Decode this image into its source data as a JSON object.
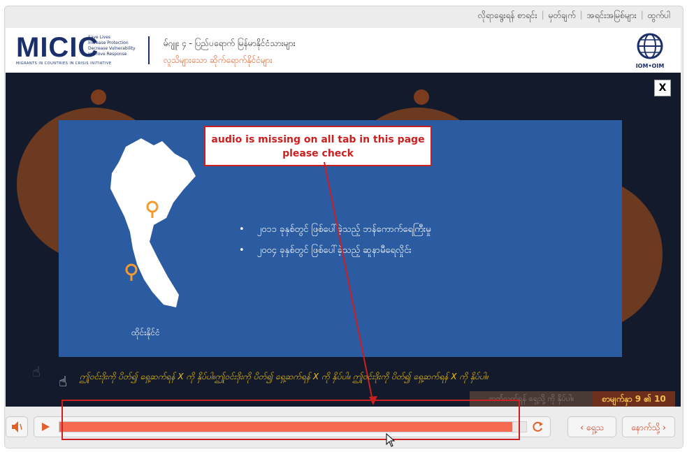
{
  "topnav": {
    "items": [
      "လိုရာရွေးရန် စာရင်း",
      "မှတ်ချက်",
      "အရင်းအမြစ်များ",
      "ထွက်ပါ"
    ]
  },
  "header": {
    "logo": "MICIC",
    "logo_tagline": [
      "Save Lives",
      "Increase Protection",
      "Decrease Vulnerability",
      "Improve Response"
    ],
    "logo_subtitle": "MIGRANTS IN COUNTRIES IN CRISIS INITIATIVE",
    "module_title": "မ်ဂျူး ၄ - ပြည်ပရောက် မြန်မာနိုင်ငံသားများ",
    "module_subtitle": "လူသိများသော ဆိုက်ရောက်နိုင်ငံများ",
    "iom_label": "IOM•OIM"
  },
  "popup": {
    "close_label": "X",
    "country_label": "ထိုင်းနိုင်ငံ",
    "bullets": [
      "၂၀၁၁ ခုနှစ်တွင် ဖြစ်ပေါ်ခဲ့သည့် ဘန်ကောက်ရေကြီးမှု",
      "၂၀၀၄ ခုနှစ်တွင် ဖြစ်ပေါ်ခဲ့သည့် ဆူနာမီရေလှိုင်း"
    ]
  },
  "annotation": {
    "line1": "audio is missing on all tab in this page",
    "line2": "please check"
  },
  "instruction": "ဤုဝင်းဒိုးကို ပိတ်၍ ရှေ့ဆက်ရန် X ကို နှိပ်ပါ။ဤုဝင်းဒိုးကို ပိတ်၍ ရှေ့ဆက်ရန် X ကို နှိပ်ပါ။ ဤုဝင်းဒိုးကို ပိတ်၍ ရှေ့ဆက်ရန် X ကို နှိပ်ပါ။",
  "footer": {
    "hint": "ဆက်လက်ရန် ရှေ့သို့ ကို နှိပ်ပါ။",
    "page_counter": "စာမျက်နှာ 9 ၏ 10",
    "prev_label": "ရှေ့သ",
    "next_label": "နောက်သို့"
  },
  "player": {
    "progress": 0.97
  },
  "colors": {
    "brand_navy": "#1b2f6b",
    "accent_orange": "#e0622a",
    "panel_blue": "#2b5ba1",
    "annotation_red": "#cc1f1f",
    "progress_fill": "#f46a52"
  }
}
